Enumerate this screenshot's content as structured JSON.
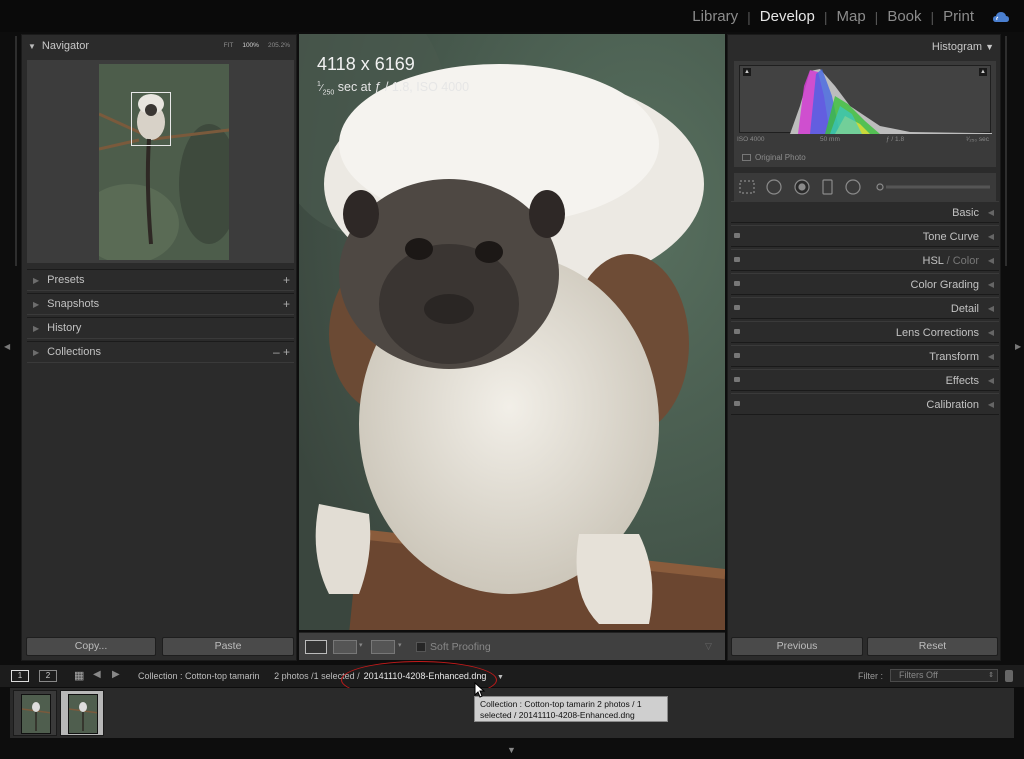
{
  "modules": {
    "items": [
      "Library",
      "Develop",
      "Map",
      "Book",
      "Print"
    ],
    "active": "Develop",
    "separator": "|"
  },
  "navigator": {
    "title": "Navigator",
    "options": [
      "FIT",
      "100%",
      "205.2%"
    ]
  },
  "left_panels": [
    {
      "label": "Presets",
      "right": "+"
    },
    {
      "label": "Snapshots",
      "right": "+"
    },
    {
      "label": "History",
      "right": ""
    },
    {
      "label": "Collections",
      "right": "–  +"
    }
  ],
  "left_buttons": {
    "copy": "Copy...",
    "paste": "Paste"
  },
  "image_info": {
    "dimensions": "4118 x 6169",
    "exposure_sup": "1",
    "exposure_sub": "250",
    "exposure_rest": " sec at ƒ / 1.8, ISO 4000"
  },
  "toolbar": {
    "soft_proofing": "Soft Proofing"
  },
  "histogram": {
    "title": "Histogram",
    "iso": "ISO 4000",
    "focal": "50 mm",
    "aperture": "ƒ / 1.8",
    "shutter": "¹⁄₂₅₀ sec",
    "original_photo": "Original Photo"
  },
  "right_panels": [
    {
      "label": "Basic",
      "switch": false
    },
    {
      "label": "Tone Curve",
      "switch": true
    },
    {
      "label": "HSL",
      "label2": " / Color",
      "switch": true
    },
    {
      "label": "Color Grading",
      "switch": true
    },
    {
      "label": "Detail",
      "switch": true
    },
    {
      "label": "Lens Corrections",
      "switch": true
    },
    {
      "label": "Transform",
      "switch": true
    },
    {
      "label": "Effects",
      "switch": true
    },
    {
      "label": "Calibration",
      "switch": true
    }
  ],
  "right_buttons": {
    "previous": "Previous",
    "reset": "Reset"
  },
  "filmstrip_bar": {
    "screen1": "1",
    "screen2": "2",
    "collection": "Collection : Cotton-top tamarin",
    "count": "2 photos /1 selected /",
    "filename": "20141110-4208-Enhanced.dng",
    "filter_label": "Filter :",
    "filter_value": "Filters Off"
  },
  "tooltip": {
    "line1": "Collection : Cotton-top tamarin      2 photos / 1",
    "line2": "selected / 20141110-4208-Enhanced.dng"
  },
  "colors": {
    "panel_bg": "#2b2b2b",
    "highlight_ellipse": "#c21a1a",
    "active_module": "#e6e6e6"
  }
}
